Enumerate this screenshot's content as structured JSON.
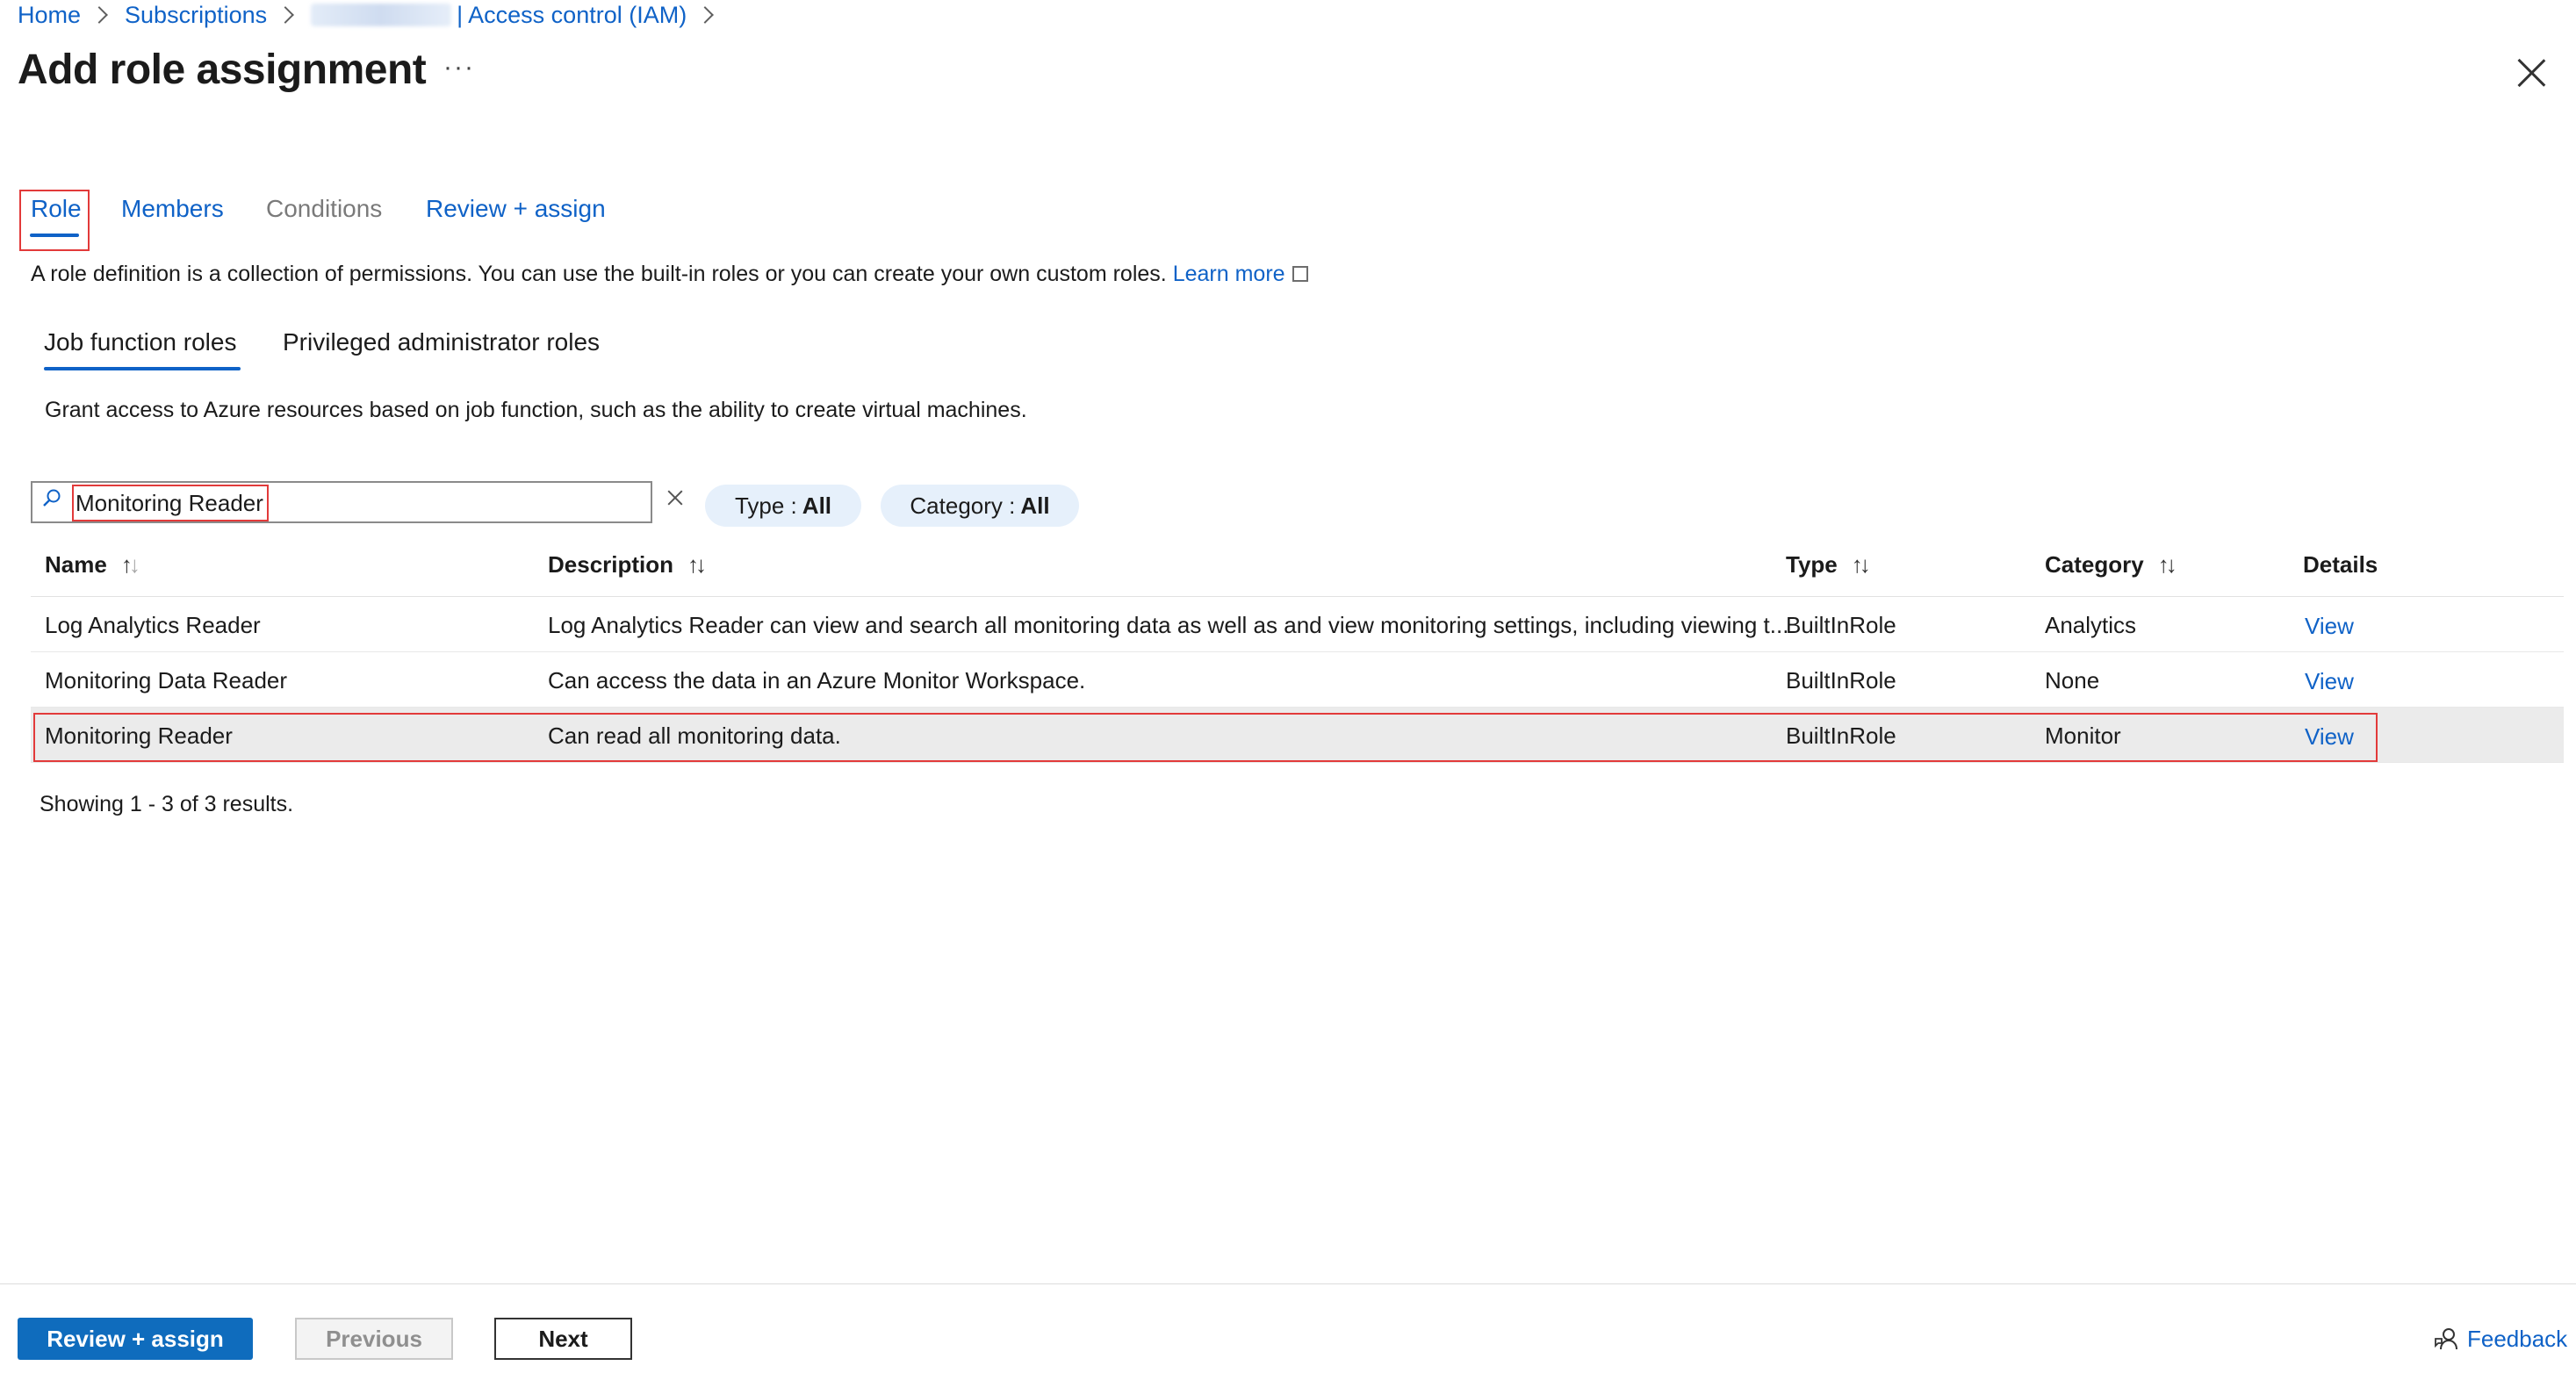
{
  "breadcrumb": {
    "home": "Home",
    "subscriptions": "Subscriptions",
    "iam": "| Access control (IAM)"
  },
  "page": {
    "title": "Add role assignment",
    "more": "···"
  },
  "wizard_tabs": [
    "Role",
    "Members",
    "Conditions",
    "Review + assign"
  ],
  "description": {
    "text": "A role definition is a collection of permissions. You can use the built-in roles or you can create your own custom roles.",
    "learn_more": "Learn more"
  },
  "sub_tabs": [
    "Job function roles",
    "Privileged administrator roles"
  ],
  "grant_text": "Grant access to Azure resources based on job function, such as the ability to create virtual machines.",
  "search": {
    "value": "Monitoring Reader"
  },
  "filters": {
    "type_label": "Type :",
    "type_value": "All",
    "category_label": "Category :",
    "category_value": "All"
  },
  "table": {
    "headers": {
      "name": "Name",
      "description": "Description",
      "type": "Type",
      "category": "Category",
      "details": "Details"
    },
    "rows": [
      {
        "name": "Log Analytics Reader",
        "description": "Log Analytics Reader can view and search all monitoring data as well as and view monitoring settings, including viewing t...",
        "type": "BuiltInRole",
        "category": "Analytics",
        "details": "View"
      },
      {
        "name": "Monitoring Data Reader",
        "description": "Can access the data in an Azure Monitor Workspace.",
        "type": "BuiltInRole",
        "category": "None",
        "details": "View"
      },
      {
        "name": "Monitoring Reader",
        "description": "Can read all monitoring data.",
        "type": "BuiltInRole",
        "category": "Monitor",
        "details": "View"
      }
    ]
  },
  "showing": "Showing 1 - 3 of 3 results.",
  "footer": {
    "review_assign": "Review + assign",
    "previous": "Previous",
    "next": "Next",
    "feedback": "Feedback"
  },
  "colors": {
    "accent": "#0f62c7",
    "primary_button": "#0f6cbd",
    "highlight_box": "#e23a3a",
    "selected_row": "#ebebeb"
  }
}
